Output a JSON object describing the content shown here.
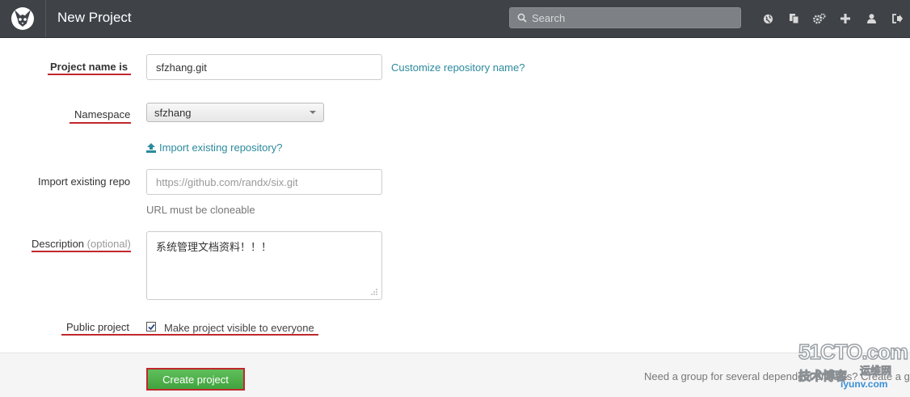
{
  "header": {
    "title": "New Project",
    "search_placeholder": "Search",
    "icons": [
      "globe-icon",
      "copy-icon",
      "cogs-icon",
      "plus-icon",
      "user-icon",
      "sign-out-icon"
    ]
  },
  "form": {
    "project_name": {
      "label": "Project name is",
      "value": "sfzhang.git",
      "link": "Customize repository name?"
    },
    "namespace": {
      "label": "Namespace",
      "selected": "sfzhang"
    },
    "import_link": "Import existing repository?",
    "import_repo": {
      "label": "Import existing repo",
      "placeholder": "https://github.com/randx/six.git",
      "help": "URL must be cloneable"
    },
    "description": {
      "label": "Description",
      "optional": "(optional)",
      "value": "系统管理文档资料！！！"
    },
    "public_project": {
      "label": "Public project",
      "checkbox_label": "Make project visible to everyone",
      "checked": true
    }
  },
  "footer": {
    "create_button": "Create project",
    "note": "Need a group for several dependent projects? Create a gro"
  },
  "watermark": {
    "line1": "51CTO.com",
    "line2": "技术博客",
    "line3": "运维网",
    "line4": "iyunv.com"
  },
  "colors": {
    "navbar": "#3f4348",
    "link": "#2b8a9d",
    "button": "#4cae49",
    "highlight": "#c1272d"
  }
}
